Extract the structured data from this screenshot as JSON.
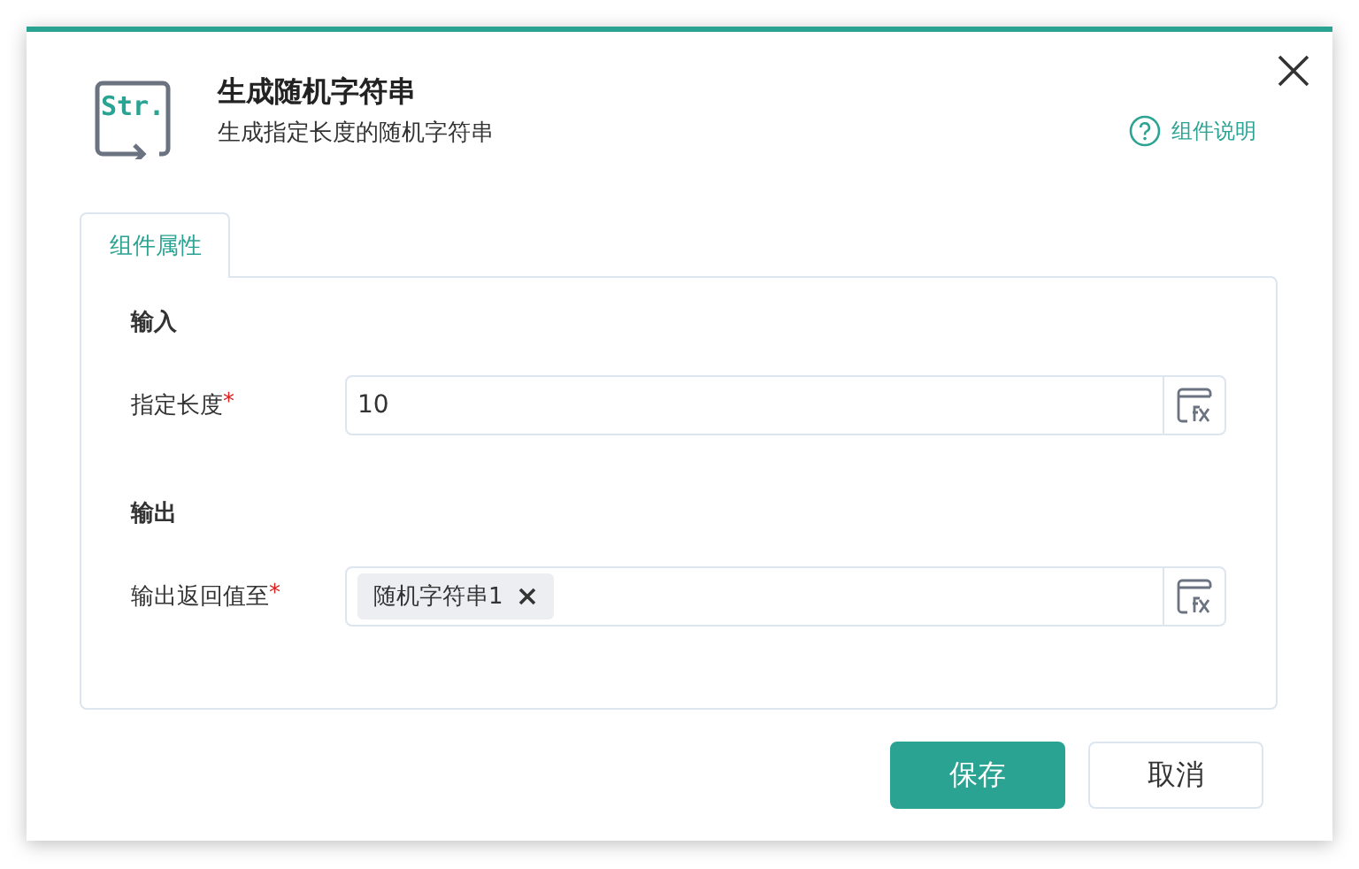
{
  "header": {
    "icon_text": "Str.",
    "title": "生成随机字符串",
    "subtitle": "生成指定长度的随机字符串",
    "help_link": "组件说明"
  },
  "tabs": [
    {
      "label": "组件属性",
      "selected": true
    }
  ],
  "sections": [
    {
      "heading": "输入",
      "fields": [
        {
          "label": "指定长度",
          "required_mark": "*",
          "kind": "text",
          "value": "10"
        }
      ]
    },
    {
      "heading": "输出",
      "fields": [
        {
          "label": "输出返回值至",
          "required_mark": "*",
          "kind": "tags",
          "tags": [
            "随机字符串1"
          ]
        }
      ]
    }
  ],
  "buttons": [
    {
      "label": "保存",
      "primary": true
    },
    {
      "label": "取消",
      "primary": false
    }
  ]
}
